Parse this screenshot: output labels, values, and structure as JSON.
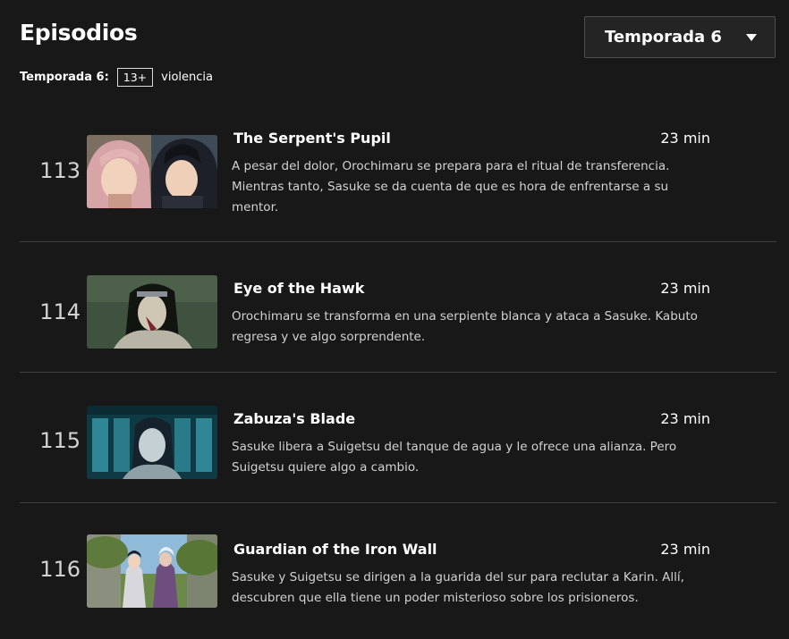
{
  "header": {
    "title": "Episodios"
  },
  "season_selector": {
    "selected": "Temporada 6"
  },
  "rating": {
    "season_label": "Temporada 6:",
    "maturity": "13+",
    "advisory": "violencia"
  },
  "episodes": [
    {
      "number": "113",
      "title": "The Serpent's Pupil",
      "duration": "23 min",
      "description": "A pesar del dolor, Orochimaru se prepara para el ritual de transferencia. Mientras tanto, Sasuke se da cuenta de que es hora de enfrentarse a su mentor."
    },
    {
      "number": "114",
      "title": "Eye of the Hawk",
      "duration": "23 min",
      "description": "Orochimaru se transforma en una serpiente blanca y ataca a Sasuke. Kabuto regresa y ve algo sorprendente."
    },
    {
      "number": "115",
      "title": "Zabuza's Blade",
      "duration": "23 min",
      "description": "Sasuke libera a Suigetsu del tanque de agua y le ofrece una alianza. Pero Suigetsu quiere algo a cambio."
    },
    {
      "number": "116",
      "title": "Guardian of the Iron Wall",
      "duration": "23 min",
      "description": "Sasuke y Suigetsu se dirigen a la guarida del sur para reclutar a Karin. Allí, descubren que ella tiene un poder misterioso sobre los prisioneros."
    }
  ]
}
